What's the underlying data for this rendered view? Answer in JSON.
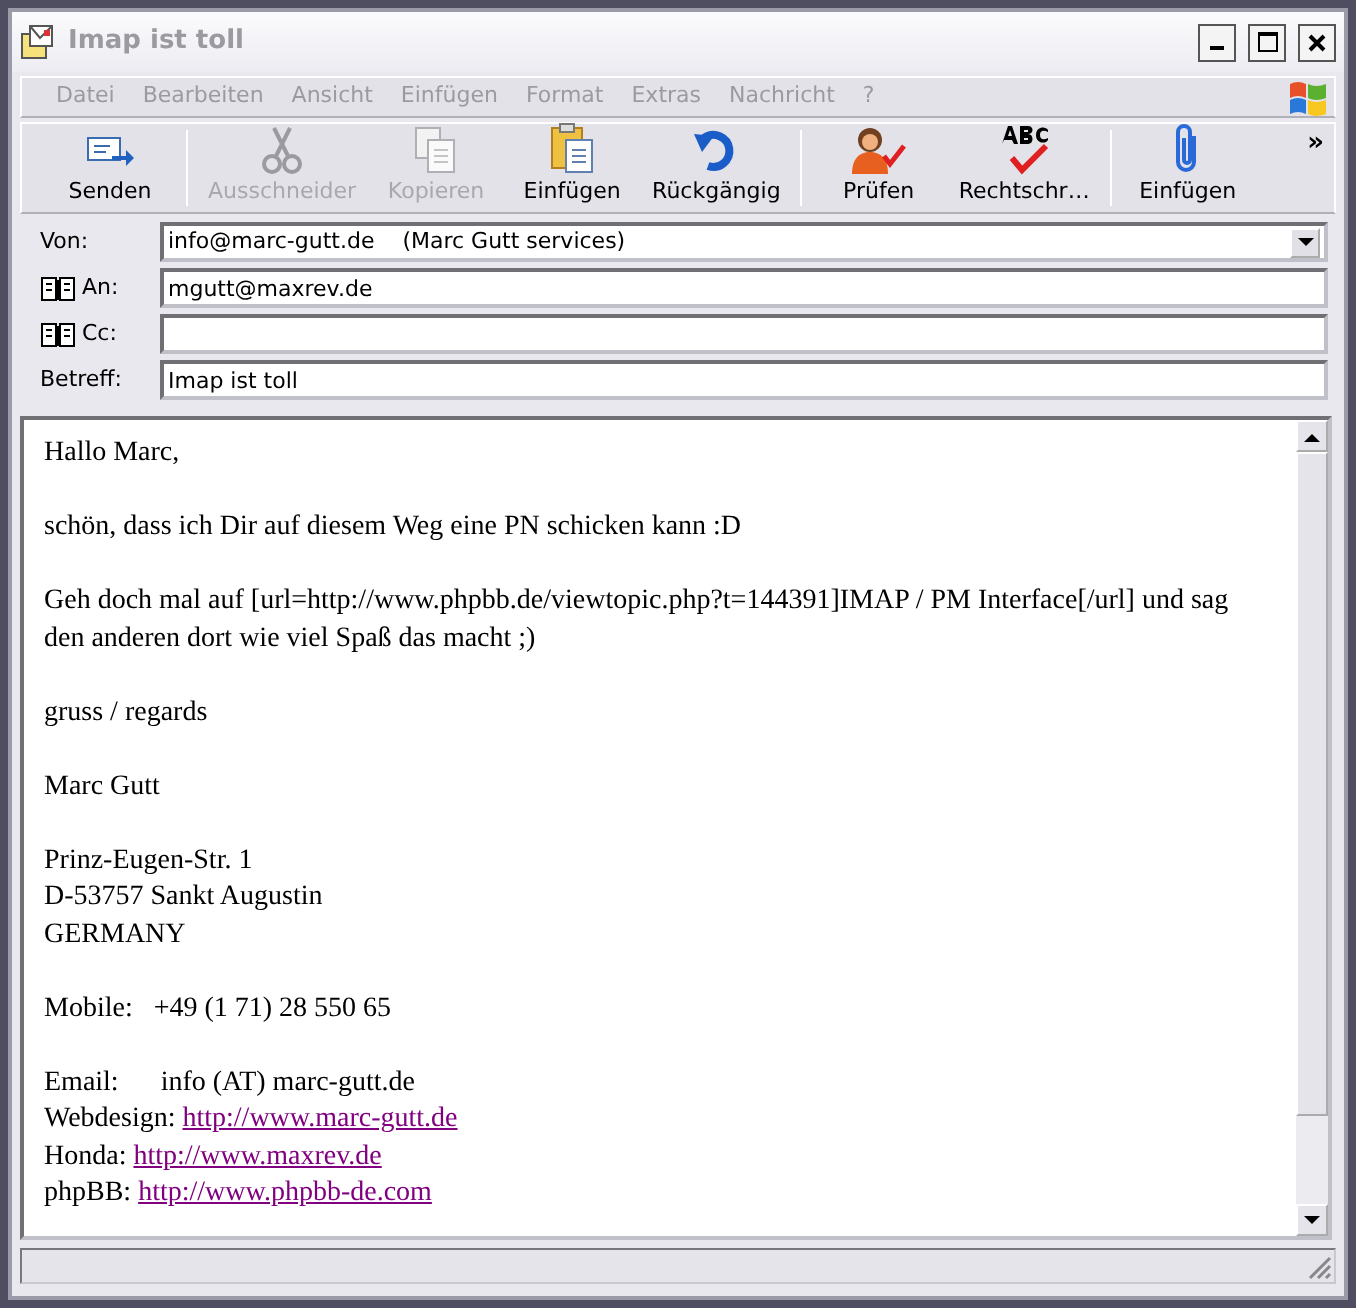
{
  "window": {
    "title": "Imap ist toll"
  },
  "menu": [
    "Datei",
    "Bearbeiten",
    "Ansicht",
    "Einfügen",
    "Format",
    "Extras",
    "Nachricht",
    "?"
  ],
  "toolbar": [
    {
      "label": "Senden",
      "kind": "send",
      "disabled": false
    },
    {
      "kind": "separator"
    },
    {
      "label": "Ausschneider",
      "kind": "cut",
      "disabled": true
    },
    {
      "label": "Kopieren",
      "kind": "copy",
      "disabled": true
    },
    {
      "label": "Einfügen",
      "kind": "paste",
      "disabled": false
    },
    {
      "label": "Rückgängig",
      "kind": "undo",
      "disabled": false
    },
    {
      "kind": "separator"
    },
    {
      "label": "Prüfen",
      "kind": "check",
      "disabled": false
    },
    {
      "label": "Rechtschr…",
      "kind": "spell",
      "disabled": false
    },
    {
      "kind": "separator"
    },
    {
      "label": "Einfügen",
      "kind": "attach",
      "disabled": false
    }
  ],
  "toolbar_more": "»",
  "fields": [
    {
      "label": "Von:",
      "kind": "dropdown",
      "value": "info@marc-gutt.de    (Marc Gutt services)"
    },
    {
      "label": "An:",
      "kind": "address",
      "value": "mgutt@maxrev.de"
    },
    {
      "label": "Cc:",
      "kind": "address"
    },
    {
      "label": "Betreff:",
      "kind": "text",
      "value": "Imap ist toll"
    }
  ],
  "body": [
    [
      {
        "text": "Hallo Marc,"
      }
    ],
    [
      {
        "text": "schön, dass ich Dir auf diesem Weg eine PN schicken kann :D"
      }
    ],
    [
      {
        "text": "Geh doch mal auf [url=http://www.phpbb.de/viewtopic.php?t=144391]IMAP / PM Interface[/url] und sag den anderen dort wie viel Spaß das macht ;)"
      }
    ],
    [
      {
        "text": "gruss / regards"
      }
    ],
    [
      {
        "text": "Marc Gutt"
      }
    ],
    [
      {
        "text": "Prinz-Eugen-Str. 1"
      },
      {
        "text": "D-53757 Sankt Augustin"
      },
      {
        "text": "GERMANY"
      }
    ],
    [
      {
        "text": "Mobile:   +49 (1 71) 28 550 65"
      }
    ],
    [
      {
        "text": "Email:      info (AT) marc-gutt.de"
      },
      {
        "text": "Webdesign:",
        "link": "http://www.marc-gutt.de"
      },
      {
        "text": "Honda:",
        "link": "http://www.maxrev.de"
      },
      {
        "text": "phpBB:",
        "link": "http://www.phpbb-de.com"
      }
    ]
  ]
}
